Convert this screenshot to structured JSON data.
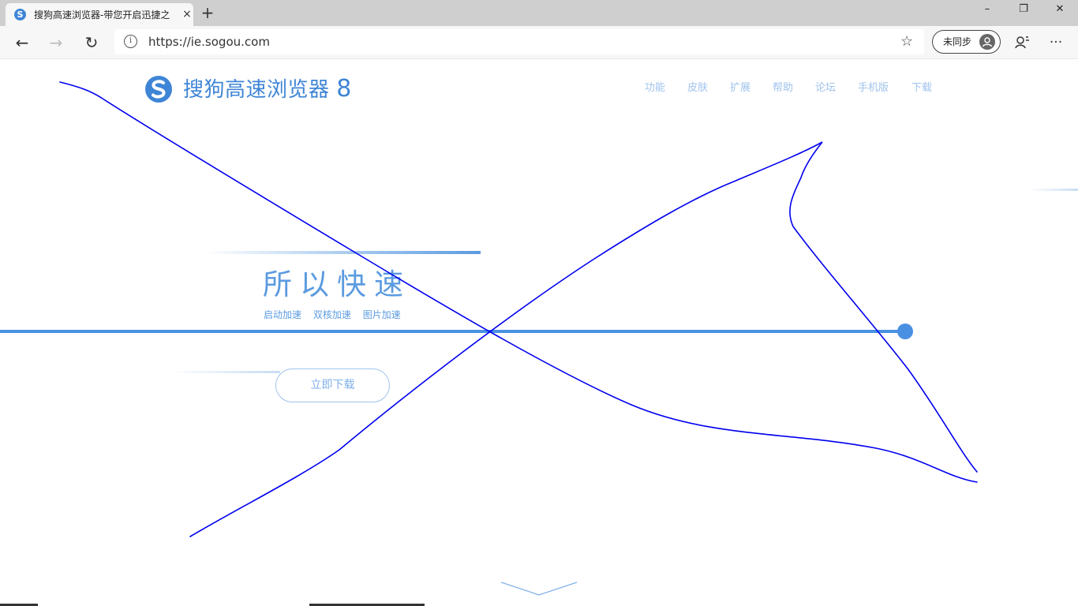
{
  "browser": {
    "tab": {
      "title": "搜狗高速浏览器-带您开启迅捷之",
      "favicon": "sogou-favicon",
      "close_icon": "×"
    },
    "new_tab_icon": "+",
    "window": {
      "minimize": "–",
      "restore": "❐",
      "close": "✕"
    },
    "nav": {
      "back": "←",
      "forward": "→",
      "refresh": "↻"
    },
    "address": {
      "info_icon": "i",
      "url": "https://ie.sogou.com",
      "star_icon": "☆"
    },
    "sync": {
      "label": "未同步",
      "avatar_icon": "person-icon"
    },
    "toolbar_icons": {
      "read_aloud": "☊",
      "more": "···"
    }
  },
  "page": {
    "logo_text": "搜狗高速浏览器",
    "logo_version": "8",
    "nav": [
      "功能",
      "皮肤",
      "扩展",
      "帮助",
      "论坛",
      "手机版",
      "下载"
    ],
    "slogan": "所以快速",
    "features": [
      "启动加速",
      "双核加速",
      "图片加速"
    ],
    "download_button": "立即下载",
    "scroll_hint_icon": "chevron-down-icon"
  },
  "colors": {
    "brand": "#3f85d6",
    "nav_text": "#9fc3ec",
    "main_line": "#4a90e2",
    "annotation_stroke": "#0000ee"
  }
}
